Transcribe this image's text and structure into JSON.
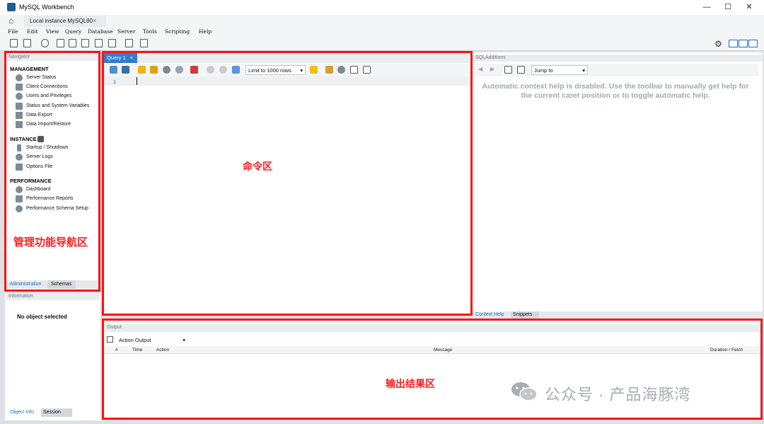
{
  "window": {
    "title": "MySQL Workbench",
    "controls": [
      "—",
      "☐",
      "✕"
    ]
  },
  "connection_tab": {
    "label": "Local instance MySQL80",
    "close": "×"
  },
  "menu": [
    "File",
    "Edit",
    "View",
    "Query",
    "Database",
    "Server",
    "Tools",
    "Scripting",
    "Help"
  ],
  "navigator": {
    "title": "Navigator",
    "sections": [
      {
        "title": "MANAGEMENT",
        "items": [
          "Server Status",
          "Client Connections",
          "Users and Privileges",
          "Status and System Variables",
          "Data Export",
          "Data Import/Restore"
        ]
      },
      {
        "title": "INSTANCE",
        "items": [
          "Startup / Shutdown",
          "Server Logs",
          "Options File"
        ]
      },
      {
        "title": "PERFORMANCE",
        "items": [
          "Dashboard",
          "Performance Reports",
          "Performance Schema Setup"
        ]
      }
    ],
    "tabs": [
      "Administration",
      "Schemas"
    ]
  },
  "information": {
    "title": "Information",
    "message": "No object selected",
    "tabs": [
      "Object Info",
      "Session"
    ]
  },
  "query": {
    "tab_label": "Query 1",
    "tab_close": "×",
    "limit_select": "Limit to 1000 rows",
    "line_number": "1"
  },
  "sql_additions": {
    "title": "SQLAdditions",
    "jump_select": "Jump to",
    "help_text": "Automatic context help is disabled. Use the toolbar to manually get help for the current caret position or to toggle automatic help.",
    "tabs": [
      "Context Help",
      "Snippets"
    ]
  },
  "output": {
    "title": "Output",
    "select": "Action Output",
    "columns": [
      "#",
      "Time",
      "Action",
      "Message",
      "Duration / Fetch"
    ]
  },
  "annotations": {
    "navigator_label": "管理功能导航区",
    "command_label": "命令区",
    "output_label": "输出结果区",
    "color": "#ff1010"
  },
  "watermark": "公众号 · 产品海豚湾"
}
